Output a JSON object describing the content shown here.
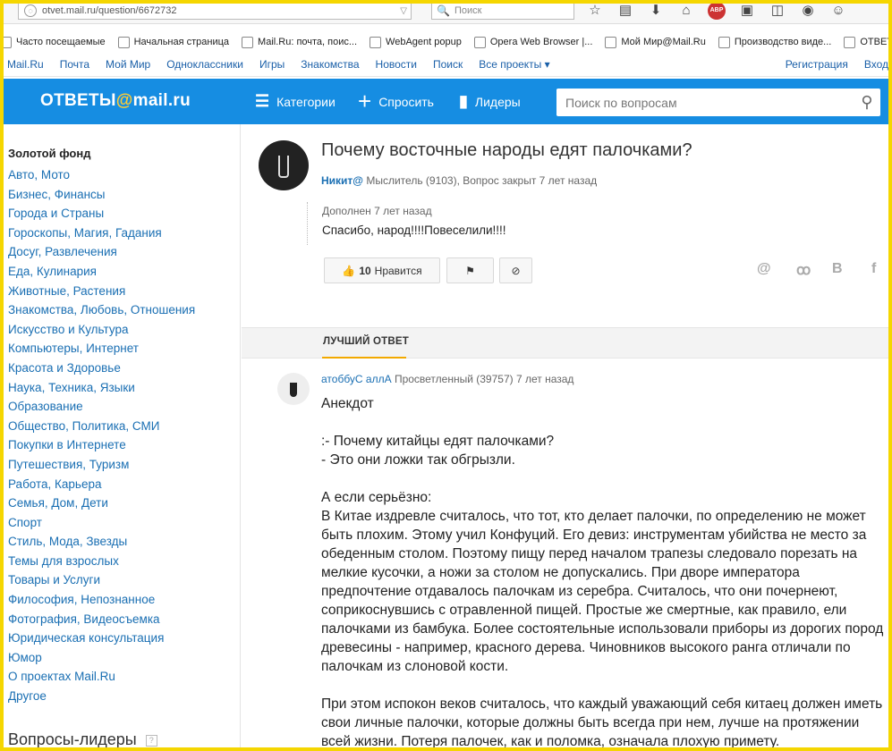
{
  "browser": {
    "url": "otvet.mail.ru/question/6672732",
    "search_placeholder": "Поиск",
    "bookmarks": [
      {
        "label": "Часто посещаемые",
        "icon": "blank-page-icon"
      },
      {
        "label": "Начальная страница",
        "icon": "blank-page-icon"
      },
      {
        "label": "Mail.Ru: почта, поис...",
        "icon": "mailru-at-icon"
      },
      {
        "label": "WebAgent popup",
        "icon": "blank-page-icon"
      },
      {
        "label": "Opera Web Browser |...",
        "icon": "opera-icon"
      },
      {
        "label": "Мой Мир@Mail.Ru",
        "icon": "moymir-icon"
      },
      {
        "label": "Производство виде...",
        "icon": "arrow-icon"
      },
      {
        "label": "ОТВЕТЫ@MAIL...",
        "icon": "otvety-icon"
      }
    ]
  },
  "topnav": {
    "left": [
      "Mail.Ru",
      "Почта",
      "Мой Мир",
      "Одноклассники",
      "Игры",
      "Знакомства",
      "Новости",
      "Поиск",
      "Все проекты ▾"
    ],
    "right": [
      "Регистрация",
      "Вход"
    ]
  },
  "header": {
    "logo_prefix": "ОТВЕТЫ",
    "logo_at": "@",
    "logo_suffix": "mail.ru",
    "categories": "Категории",
    "ask": "Спросить",
    "leaders": "Лидеры",
    "search_placeholder": "Поиск по вопросам"
  },
  "sidebar": {
    "gold": "Золотой фонд",
    "categories": [
      "Авто, Мото",
      "Бизнес, Финансы",
      "Города и Страны",
      "Гороскопы, Магия, Гадания",
      "Досуг, Развлечения",
      "Еда, Кулинария",
      "Животные, Растения",
      "Знакомства, Любовь, Отношения",
      "Искусство и Культура",
      "Компьютеры, Интернет",
      "Красота и Здоровье",
      "Наука, Техника, Языки",
      "Образование",
      "Общество, Политика, СМИ",
      "Покупки в Интернете",
      "Путешествия, Туризм",
      "Работа, Карьера",
      "Семья, Дом, Дети",
      "Спорт",
      "Стиль, Мода, Звезды",
      "Темы для взрослых",
      "Товары и Услуги",
      "Философия, Непознанное",
      "Фотография, Видеосъемка",
      "Юридическая консультация",
      "Юмор",
      "О проектах Mail.Ru",
      "Другое"
    ],
    "leaders_title": "Вопросы-лидеры",
    "leaders_help": "?"
  },
  "question": {
    "title": "Почему восточные народы едят палочками?",
    "author": "Никит@",
    "meta": " Мыслитель (9103), Вопрос закрыт 7 лет назад",
    "added_label": "Дополнен 7 лет назад",
    "added_text": "Спасибо, народ!!!!Повеселили!!!!",
    "likes_count": "10",
    "likes_label": "Нравится"
  },
  "best": {
    "tab": "ЛУЧШИЙ ОТВЕТ",
    "author": "атоббуС аллА",
    "meta": " Просветленный (39757) 7 лет назад",
    "paragraphs": [
      "Анекдот",
      ":- Почему китайцы едят палочками?\n - Это они ложки так обгрызли.",
      "А если серьёзно:\nВ Китае издревле считалось, что тот, кто делает палочки, по определению не может быть плохим. Этому учил Конфуций. Его девиз: инструментам убийства не место за обеденным столом. Поэтому пищу перед началом трапезы следовало порезать на мелкие кусочки, а ножи за столом не допускались. При дворе императора предпочтение отдавалось палочкам из серебра. Считалось, что они почернеют, соприкоснувшись с отравленной пищей. Простые же смертные, как правило, ели палочками из бамбука. Более состоятельные использовали приборы из дорогих пород древесины - например, красного дерева. Чиновников высокого ранга отличали по палочкам из слоновой кости.",
      "При этом испокон веков считалось, что каждый уважающий себя китаец должен иметь свои личные палочки, которые должны быть всегда при нем, лучше на протяжении всей жизни. Потеря палочек, как и поломка, означала плохую примету."
    ]
  },
  "colors": {
    "brand_blue": "#168de2",
    "link": "#1a6fb3",
    "accent": "#f2a900",
    "frame": "#f5d600"
  }
}
